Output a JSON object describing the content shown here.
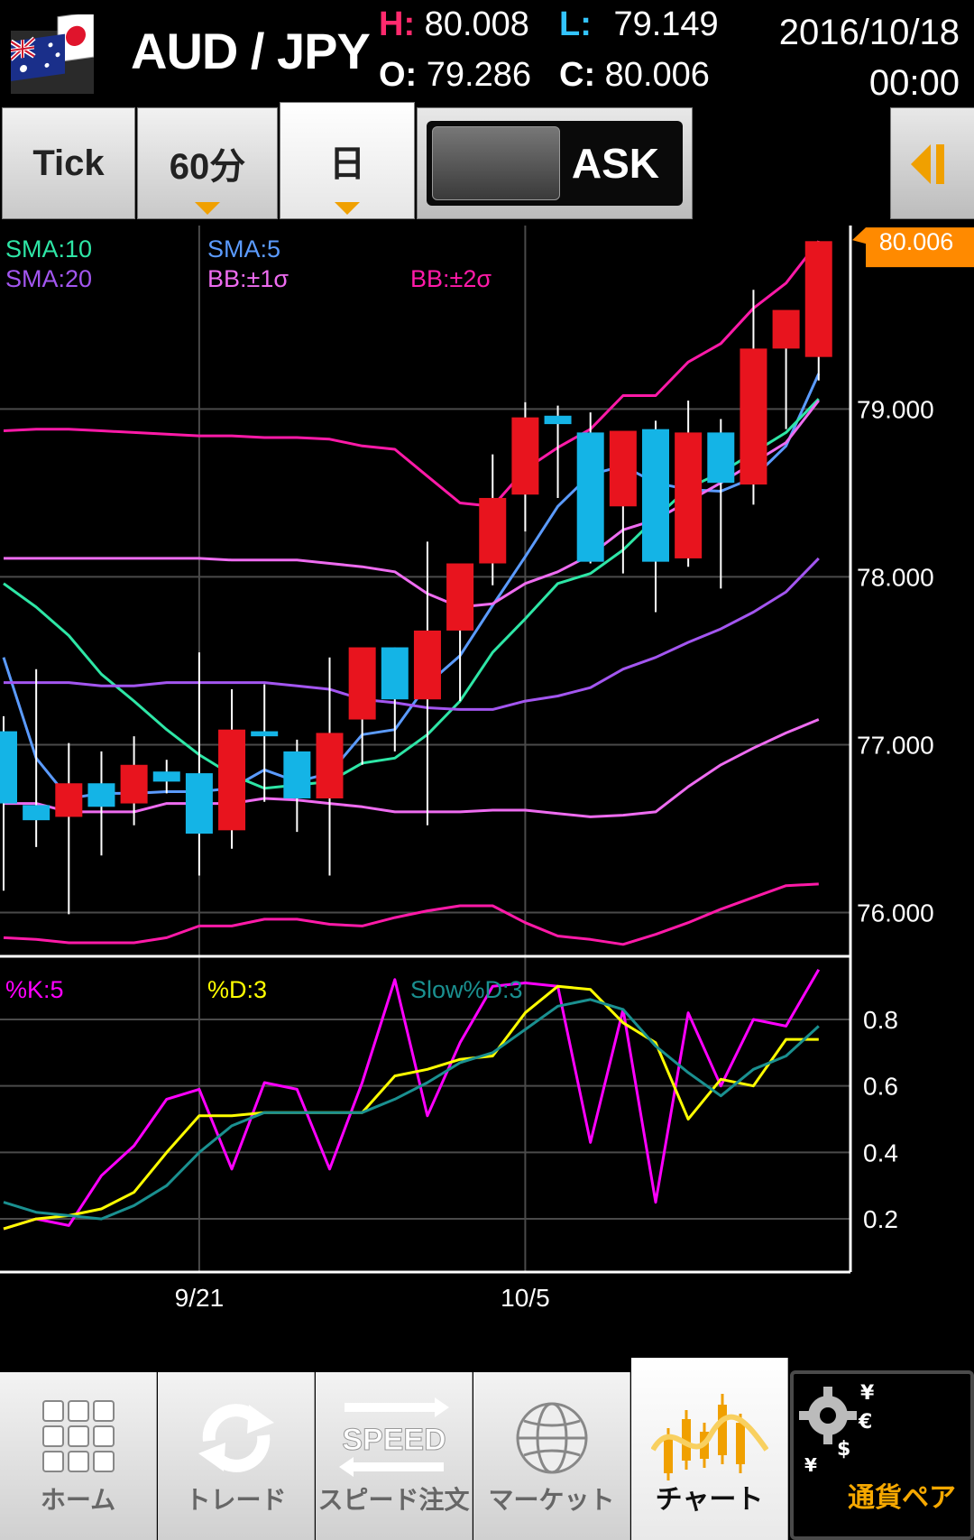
{
  "header": {
    "pair": "AUD / JPY",
    "high_key": "H:",
    "high": "80.008",
    "low_key": "L:",
    "low": "79.149",
    "open_key": "O:",
    "open": "79.286",
    "close_key": "C:",
    "close": "80.006",
    "date": "2016/10/18",
    "time": "00:00",
    "colors": {
      "high": "#ff2a6d",
      "low": "#33c4ff"
    }
  },
  "toolbar": {
    "tabs": [
      {
        "label": "Tick",
        "dropdown": false,
        "selected": false
      },
      {
        "label": "60分",
        "dropdown": true,
        "selected": false
      },
      {
        "label": "日",
        "dropdown": true,
        "selected": true
      }
    ],
    "side_label": "ASK",
    "collapse_icon": "chevron-left-icon"
  },
  "chart_data": [
    {
      "type": "candlestick",
      "title": "",
      "x_labels": [
        {
          "index": 6,
          "label": "9/21"
        },
        {
          "index": 16,
          "label": "10/5"
        }
      ],
      "y_ticks": [
        79,
        78,
        77,
        76
      ],
      "y_tick_labels": [
        "79.000",
        "78.000",
        "77.000",
        "76.000"
      ],
      "ylim": [
        75.75,
        80.05
      ],
      "grid": true,
      "price_tag": {
        "value": 80.006,
        "label": "80.006",
        "color": "#ff8a00"
      },
      "legend": [
        {
          "name": "SMA:10",
          "color": "#2ee6a6"
        },
        {
          "name": "SMA:5",
          "color": "#5b9bff"
        },
        {
          "name": "SMA:20",
          "color": "#a356f0"
        },
        {
          "name": "BB:±1σ",
          "color": "#ee6cf0"
        },
        {
          "name": "BB:±2σ",
          "color": "#ff1aa8"
        }
      ],
      "colors": {
        "up": "#e8141e",
        "down": "#14b4e6"
      },
      "candles": [
        {
          "o": 77.08,
          "h": 77.17,
          "l": 76.13,
          "c": 76.65
        },
        {
          "o": 76.64,
          "h": 77.45,
          "l": 76.39,
          "c": 76.55
        },
        {
          "o": 76.57,
          "h": 77.01,
          "l": 75.99,
          "c": 76.77
        },
        {
          "o": 76.77,
          "h": 76.96,
          "l": 76.34,
          "c": 76.63
        },
        {
          "o": 76.65,
          "h": 77.05,
          "l": 76.52,
          "c": 76.88
        },
        {
          "o": 76.84,
          "h": 76.91,
          "l": 76.71,
          "c": 76.78
        },
        {
          "o": 76.83,
          "h": 77.55,
          "l": 76.22,
          "c": 76.47
        },
        {
          "o": 76.49,
          "h": 77.33,
          "l": 76.38,
          "c": 77.09
        },
        {
          "o": 77.08,
          "h": 77.36,
          "l": 76.66,
          "c": 77.05
        },
        {
          "o": 76.96,
          "h": 77.03,
          "l": 76.48,
          "c": 76.68
        },
        {
          "o": 76.68,
          "h": 77.52,
          "l": 76.22,
          "c": 77.07
        },
        {
          "o": 77.15,
          "h": 77.55,
          "l": 76.88,
          "c": 77.58
        },
        {
          "o": 77.58,
          "h": 77.58,
          "l": 76.96,
          "c": 77.27
        },
        {
          "o": 77.27,
          "h": 78.21,
          "l": 76.52,
          "c": 77.68
        },
        {
          "o": 77.68,
          "h": 77.78,
          "l": 77.26,
          "c": 78.08
        },
        {
          "o": 78.08,
          "h": 78.73,
          "l": 77.95,
          "c": 78.47
        },
        {
          "o": 78.49,
          "h": 79.04,
          "l": 78.27,
          "c": 78.95
        },
        {
          "o": 78.96,
          "h": 79.02,
          "l": 78.47,
          "c": 78.91
        },
        {
          "o": 78.86,
          "h": 78.98,
          "l": 78.08,
          "c": 78.09
        },
        {
          "o": 78.42,
          "h": 78.86,
          "l": 78.02,
          "c": 78.87
        },
        {
          "o": 78.88,
          "h": 78.93,
          "l": 77.79,
          "c": 78.09
        },
        {
          "o": 78.11,
          "h": 79.05,
          "l": 78.06,
          "c": 78.86
        },
        {
          "o": 78.86,
          "h": 78.94,
          "l": 77.93,
          "c": 78.56
        },
        {
          "o": 78.55,
          "h": 79.71,
          "l": 78.43,
          "c": 79.36
        },
        {
          "o": 79.36,
          "h": 79.54,
          "l": 78.88,
          "c": 79.59
        },
        {
          "o": 79.31,
          "h": 80.0,
          "l": 79.17,
          "c": 80.0
        }
      ],
      "series": [
        {
          "name": "SMA:5",
          "color": "#5b9bff",
          "values": [
            77.52,
            76.92,
            76.68,
            76.71,
            76.71,
            76.72,
            76.72,
            76.74,
            76.85,
            76.78,
            76.83,
            77.06,
            77.09,
            77.36,
            77.53,
            77.83,
            78.12,
            78.42,
            78.61,
            78.66,
            78.56,
            78.52,
            78.51,
            78.59,
            78.78,
            79.21
          ]
        },
        {
          "name": "SMA:10",
          "color": "#2ee6a6",
          "values": [
            77.96,
            77.82,
            77.65,
            77.42,
            77.26,
            77.09,
            76.94,
            76.82,
            76.74,
            76.76,
            76.78,
            76.89,
            76.92,
            77.06,
            77.26,
            77.55,
            77.75,
            77.96,
            78.02,
            78.16,
            78.35,
            78.53,
            78.62,
            78.74,
            78.86,
            79.06
          ]
        },
        {
          "name": "SMA:20",
          "color": "#a356f0",
          "values": [
            77.37,
            77.37,
            77.37,
            77.35,
            77.35,
            77.37,
            77.37,
            77.37,
            77.37,
            77.35,
            77.33,
            77.27,
            77.25,
            77.22,
            77.21,
            77.21,
            77.26,
            77.29,
            77.34,
            77.45,
            77.52,
            77.61,
            77.69,
            77.79,
            77.91,
            78.11
          ]
        },
        {
          "name": "BB:+1σ",
          "color": "#ee6cf0",
          "values": [
            78.11,
            78.11,
            78.11,
            78.11,
            78.11,
            78.11,
            78.11,
            78.1,
            78.1,
            78.1,
            78.08,
            78.06,
            78.03,
            77.9,
            77.82,
            77.84,
            77.96,
            78.03,
            78.13,
            78.28,
            78.34,
            78.45,
            78.56,
            78.68,
            78.8,
            79.05
          ]
        },
        {
          "name": "BB:−1σ",
          "color": "#ee6cf0",
          "values": [
            76.65,
            76.65,
            76.6,
            76.6,
            76.6,
            76.65,
            76.65,
            76.65,
            76.68,
            76.67,
            76.65,
            76.63,
            76.6,
            76.6,
            76.6,
            76.61,
            76.61,
            76.59,
            76.57,
            76.58,
            76.6,
            76.75,
            76.88,
            76.98,
            77.07,
            77.15
          ]
        },
        {
          "name": "BB:+2σ",
          "color": "#ff1aa8",
          "values": [
            78.87,
            78.88,
            78.88,
            78.87,
            78.86,
            78.85,
            78.84,
            78.84,
            78.83,
            78.83,
            78.82,
            78.78,
            78.76,
            78.6,
            78.44,
            78.42,
            78.64,
            78.77,
            78.88,
            79.08,
            79.08,
            79.28,
            79.39,
            79.6,
            79.75,
            80.0
          ]
        },
        {
          "name": "BB:−2σ",
          "color": "#ff1aa8",
          "values": [
            75.85,
            75.84,
            75.82,
            75.82,
            75.82,
            75.85,
            75.92,
            75.92,
            75.96,
            75.96,
            75.93,
            75.92,
            75.97,
            76.01,
            76.04,
            76.04,
            75.94,
            75.86,
            75.84,
            75.81,
            75.87,
            75.94,
            76.02,
            76.09,
            76.16,
            76.17
          ]
        }
      ]
    },
    {
      "type": "line",
      "title": "",
      "y_ticks": [
        0.8,
        0.6,
        0.4,
        0.2
      ],
      "y_tick_labels": [
        "0.8",
        "0.6",
        "0.4",
        "0.2"
      ],
      "ylim": [
        0.04,
        0.99
      ],
      "grid": true,
      "series": [
        {
          "name": "%K:5",
          "color": "#ff00ff",
          "values": [
            0.17,
            0.2,
            0.18,
            0.33,
            0.42,
            0.56,
            0.59,
            0.35,
            0.61,
            0.59,
            0.35,
            0.61,
            0.92,
            0.51,
            0.73,
            0.9,
            0.91,
            0.9,
            0.43,
            0.83,
            0.25,
            0.82,
            0.6,
            0.8,
            0.78,
            0.95
          ]
        },
        {
          "name": "%D:3",
          "color": "#ffff00",
          "values": [
            0.17,
            0.2,
            0.21,
            0.23,
            0.28,
            0.4,
            0.51,
            0.51,
            0.52,
            0.52,
            0.52,
            0.52,
            0.63,
            0.65,
            0.68,
            0.69,
            0.82,
            0.9,
            0.89,
            0.79,
            0.73,
            0.5,
            0.62,
            0.6,
            0.74,
            0.74
          ]
        },
        {
          "name": "Slow%D:3",
          "color": "#1a9090",
          "values": [
            0.25,
            0.22,
            0.21,
            0.2,
            0.24,
            0.3,
            0.4,
            0.48,
            0.52,
            0.52,
            0.52,
            0.52,
            0.56,
            0.61,
            0.67,
            0.7,
            0.77,
            0.84,
            0.86,
            0.83,
            0.72,
            0.64,
            0.57,
            0.65,
            0.69,
            0.78
          ]
        }
      ]
    }
  ],
  "nav": [
    {
      "label": "ホーム",
      "icon": "grid-icon",
      "selected": false
    },
    {
      "label": "トレード",
      "icon": "refresh-arrows-icon",
      "selected": false
    },
    {
      "label": "スピード注文",
      "icon": "speed-icon",
      "icon_text": "SPEED",
      "selected": false
    },
    {
      "label": "マーケット",
      "icon": "globe-icon",
      "selected": false
    },
    {
      "label": "チャート",
      "icon": "chart-icon",
      "selected": true
    }
  ],
  "currency_pair": {
    "label": "通貨ペア",
    "icon": "gear-currency-icon"
  }
}
